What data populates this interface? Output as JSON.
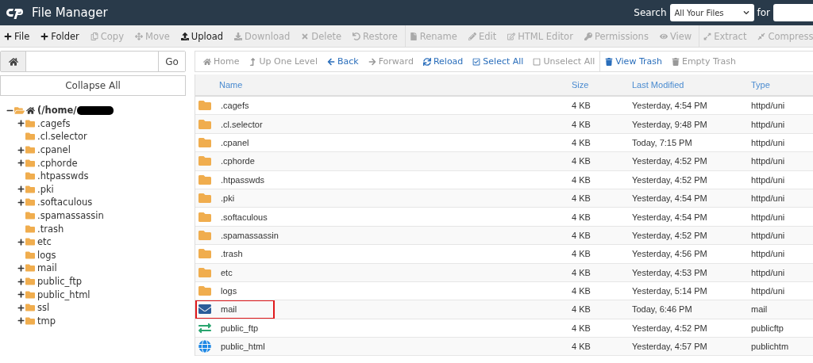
{
  "header": {
    "title": "File Manager",
    "search_label": "Search",
    "search_scope": "All Your Files",
    "for_label": "for"
  },
  "toolbar": [
    {
      "label": "File",
      "disabled": false
    },
    {
      "label": "Folder",
      "disabled": false
    },
    {
      "label": "Copy",
      "disabled": true
    },
    {
      "label": "Move",
      "disabled": true
    },
    {
      "label": "Upload",
      "disabled": false
    },
    {
      "label": "Download",
      "disabled": true
    },
    {
      "label": "Delete",
      "disabled": true
    },
    {
      "label": "Restore",
      "disabled": true
    },
    {
      "label": "Rename",
      "disabled": true,
      "group_start": true
    },
    {
      "label": "Edit",
      "disabled": true
    },
    {
      "label": "HTML Editor",
      "disabled": true
    },
    {
      "label": "Permissions",
      "disabled": true
    },
    {
      "label": "View",
      "disabled": true
    },
    {
      "label": "Extract",
      "disabled": true,
      "group_start": true
    },
    {
      "label": "Compress",
      "disabled": true
    }
  ],
  "sidebar": {
    "go_label": "Go",
    "collapse_label": "Collapse All",
    "tree": {
      "label": "(/home/",
      "expanded": true,
      "redacted": true,
      "children": [
        {
          "label": ".cagefs",
          "has_children": true
        },
        {
          "label": ".cl.selector",
          "has_children": false
        },
        {
          "label": ".cpanel",
          "has_children": true
        },
        {
          "label": ".cphorde",
          "has_children": true
        },
        {
          "label": ".htpasswds",
          "has_children": false
        },
        {
          "label": ".pki",
          "has_children": true
        },
        {
          "label": ".softaculous",
          "has_children": true
        },
        {
          "label": ".spamassassin",
          "has_children": false
        },
        {
          "label": ".trash",
          "has_children": false
        },
        {
          "label": "etc",
          "has_children": true
        },
        {
          "label": "logs",
          "has_children": false
        },
        {
          "label": "mail",
          "has_children": true
        },
        {
          "label": "public_ftp",
          "has_children": true
        },
        {
          "label": "public_html",
          "has_children": true
        },
        {
          "label": "ssl",
          "has_children": true
        },
        {
          "label": "tmp",
          "has_children": true
        }
      ]
    }
  },
  "navbar": [
    {
      "label": "Home",
      "disabled": true
    },
    {
      "label": "Up One Level",
      "disabled": true
    },
    {
      "label": "Back",
      "disabled": false
    },
    {
      "label": "Forward",
      "disabled": true
    },
    {
      "label": "Reload",
      "disabled": false
    },
    {
      "label": "Select All",
      "disabled": false
    },
    {
      "label": "Unselect All",
      "disabled": true
    },
    {
      "label": "View Trash",
      "disabled": false,
      "group_start": true
    },
    {
      "label": "Empty Trash",
      "disabled": true
    }
  ],
  "table": {
    "columns": [
      "Name",
      "Size",
      "Last Modified",
      "Type"
    ],
    "rows": [
      {
        "kind": "folder",
        "name": ".cagefs",
        "size": "4 KB",
        "modified": "Yesterday, 4:54 PM",
        "type": "httpd/uni",
        "highlighted": false
      },
      {
        "kind": "folder",
        "name": ".cl.selector",
        "size": "4 KB",
        "modified": "Yesterday, 9:48 PM",
        "type": "httpd/uni",
        "highlighted": false
      },
      {
        "kind": "folder",
        "name": ".cpanel",
        "size": "4 KB",
        "modified": "Today, 7:15 PM",
        "type": "httpd/uni",
        "highlighted": false
      },
      {
        "kind": "folder",
        "name": ".cphorde",
        "size": "4 KB",
        "modified": "Yesterday, 4:52 PM",
        "type": "httpd/uni",
        "highlighted": false
      },
      {
        "kind": "folder",
        "name": ".htpasswds",
        "size": "4 KB",
        "modified": "Yesterday, 4:52 PM",
        "type": "httpd/uni",
        "highlighted": false
      },
      {
        "kind": "folder",
        "name": ".pki",
        "size": "4 KB",
        "modified": "Yesterday, 4:54 PM",
        "type": "httpd/uni",
        "highlighted": false
      },
      {
        "kind": "folder",
        "name": ".softaculous",
        "size": "4 KB",
        "modified": "Yesterday, 4:54 PM",
        "type": "httpd/uni",
        "highlighted": false
      },
      {
        "kind": "folder",
        "name": ".spamassassin",
        "size": "4 KB",
        "modified": "Yesterday, 4:52 PM",
        "type": "httpd/uni",
        "highlighted": false
      },
      {
        "kind": "folder",
        "name": ".trash",
        "size": "4 KB",
        "modified": "Yesterday, 4:56 PM",
        "type": "httpd/uni",
        "highlighted": false
      },
      {
        "kind": "folder",
        "name": "etc",
        "size": "4 KB",
        "modified": "Yesterday, 4:53 PM",
        "type": "httpd/uni",
        "highlighted": false
      },
      {
        "kind": "folder",
        "name": "logs",
        "size": "4 KB",
        "modified": "Yesterday, 5:14 PM",
        "type": "httpd/uni",
        "highlighted": false
      },
      {
        "kind": "mail",
        "name": "mail",
        "size": "4 KB",
        "modified": "Today, 6:46 PM",
        "type": "mail",
        "highlighted": true
      },
      {
        "kind": "ftp",
        "name": "public_ftp",
        "size": "4 KB",
        "modified": "Yesterday, 4:52 PM",
        "type": "publicftp",
        "highlighted": false
      },
      {
        "kind": "web",
        "name": "public_html",
        "size": "4 KB",
        "modified": "Yesterday, 4:57 PM",
        "type": "publichtm",
        "highlighted": false
      }
    ]
  }
}
